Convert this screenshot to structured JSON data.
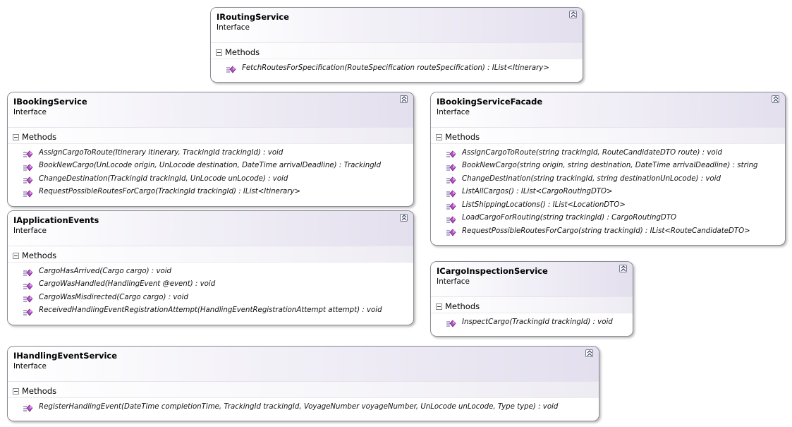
{
  "interfaces": [
    {
      "id": "routing",
      "name": "IRoutingService",
      "kind": "Interface",
      "section": "Methods",
      "methods": [
        "FetchRoutesForSpecification(RouteSpecification routeSpecification) : IList<Itinerary>"
      ]
    },
    {
      "id": "booking",
      "name": "IBookingService",
      "kind": "Interface",
      "section": "Methods",
      "methods": [
        "AssignCargoToRoute(Itinerary itinerary, TrackingId trackingId) : void",
        "BookNewCargo(UnLocode origin, UnLocode destination, DateTime arrivalDeadline) : TrackingId",
        "ChangeDestination(TrackingId trackingId, UnLocode unLocode) : void",
        "RequestPossibleRoutesForCargo(TrackingId trackingId) : IList<Itinerary>"
      ]
    },
    {
      "id": "booking_facade",
      "name": "IBookingServiceFacade",
      "kind": "Interface",
      "section": "Methods",
      "methods": [
        "AssignCargoToRoute(string trackingId, RouteCandidateDTO route) : void",
        "BookNewCargo(string origin, string destination, DateTime arrivalDeadline) : string",
        "ChangeDestination(string trackingId, string destinationUnLocode) : void",
        "ListAllCargos() : IList<CargoRoutingDTO>",
        "ListShippingLocations() : IList<LocationDTO>",
        "LoadCargoForRouting(string trackingId) : CargoRoutingDTO",
        "RequestPossibleRoutesForCargo(string trackingId) : IList<RouteCandidateDTO>"
      ]
    },
    {
      "id": "app_events",
      "name": "IApplicationEvents",
      "kind": "Interface",
      "section": "Methods",
      "methods": [
        "CargoHasArrived(Cargo cargo) : void",
        "CargoWasHandled(HandlingEvent @event) : void",
        "CargoWasMisdirected(Cargo cargo) : void",
        "ReceivedHandlingEventRegistrationAttempt(HandlingEventRegistrationAttempt attempt) : void"
      ]
    },
    {
      "id": "cargo_inspection",
      "name": "ICargoInspectionService",
      "kind": "Interface",
      "section": "Methods",
      "methods": [
        "InspectCargo(TrackingId trackingId) : void"
      ]
    },
    {
      "id": "handling_event",
      "name": "IHandlingEventService",
      "kind": "Interface",
      "section": "Methods",
      "methods": [
        "RegisterHandlingEvent(DateTime completionTime, TrackingId trackingId, VoyageNumber voyageNumber, UnLocode unLocode, Type type) : void"
      ]
    }
  ]
}
